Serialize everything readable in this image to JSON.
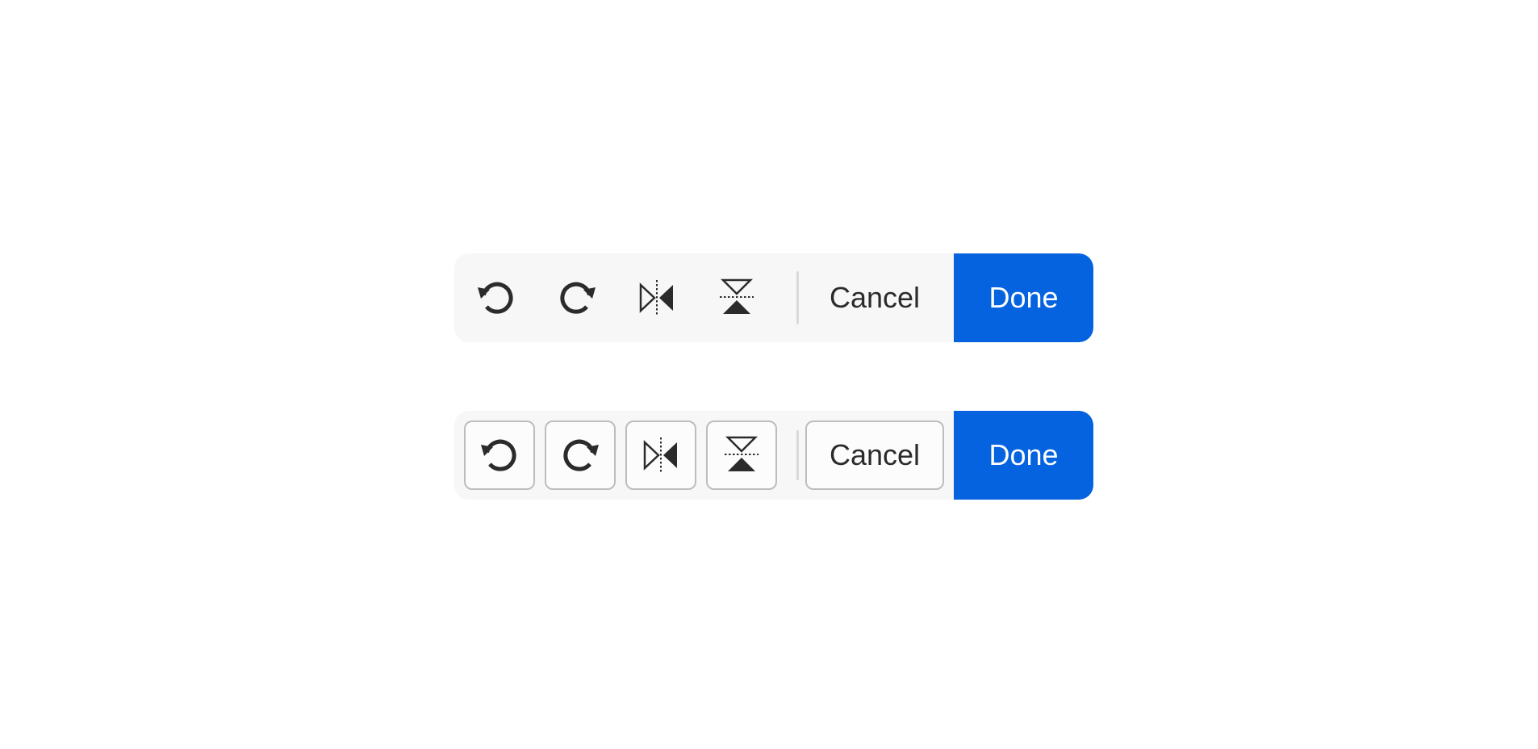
{
  "toolbars": [
    {
      "variant": "quiet",
      "tools": [
        {
          "icon": "rotate-left-icon"
        },
        {
          "icon": "rotate-right-icon"
        },
        {
          "icon": "flip-horizontal-icon"
        },
        {
          "icon": "flip-vertical-icon"
        }
      ],
      "cancel_label": "Cancel",
      "done_label": "Done"
    },
    {
      "variant": "outlined",
      "tools": [
        {
          "icon": "rotate-left-icon"
        },
        {
          "icon": "rotate-right-icon"
        },
        {
          "icon": "flip-horizontal-icon"
        },
        {
          "icon": "flip-vertical-icon"
        }
      ],
      "cancel_label": "Cancel",
      "done_label": "Done"
    }
  ],
  "colors": {
    "accent": "#0563e0",
    "toolbar_bg": "#f7f7f7",
    "icon": "#2b2b2b",
    "button_border": "#bdbdbd"
  }
}
